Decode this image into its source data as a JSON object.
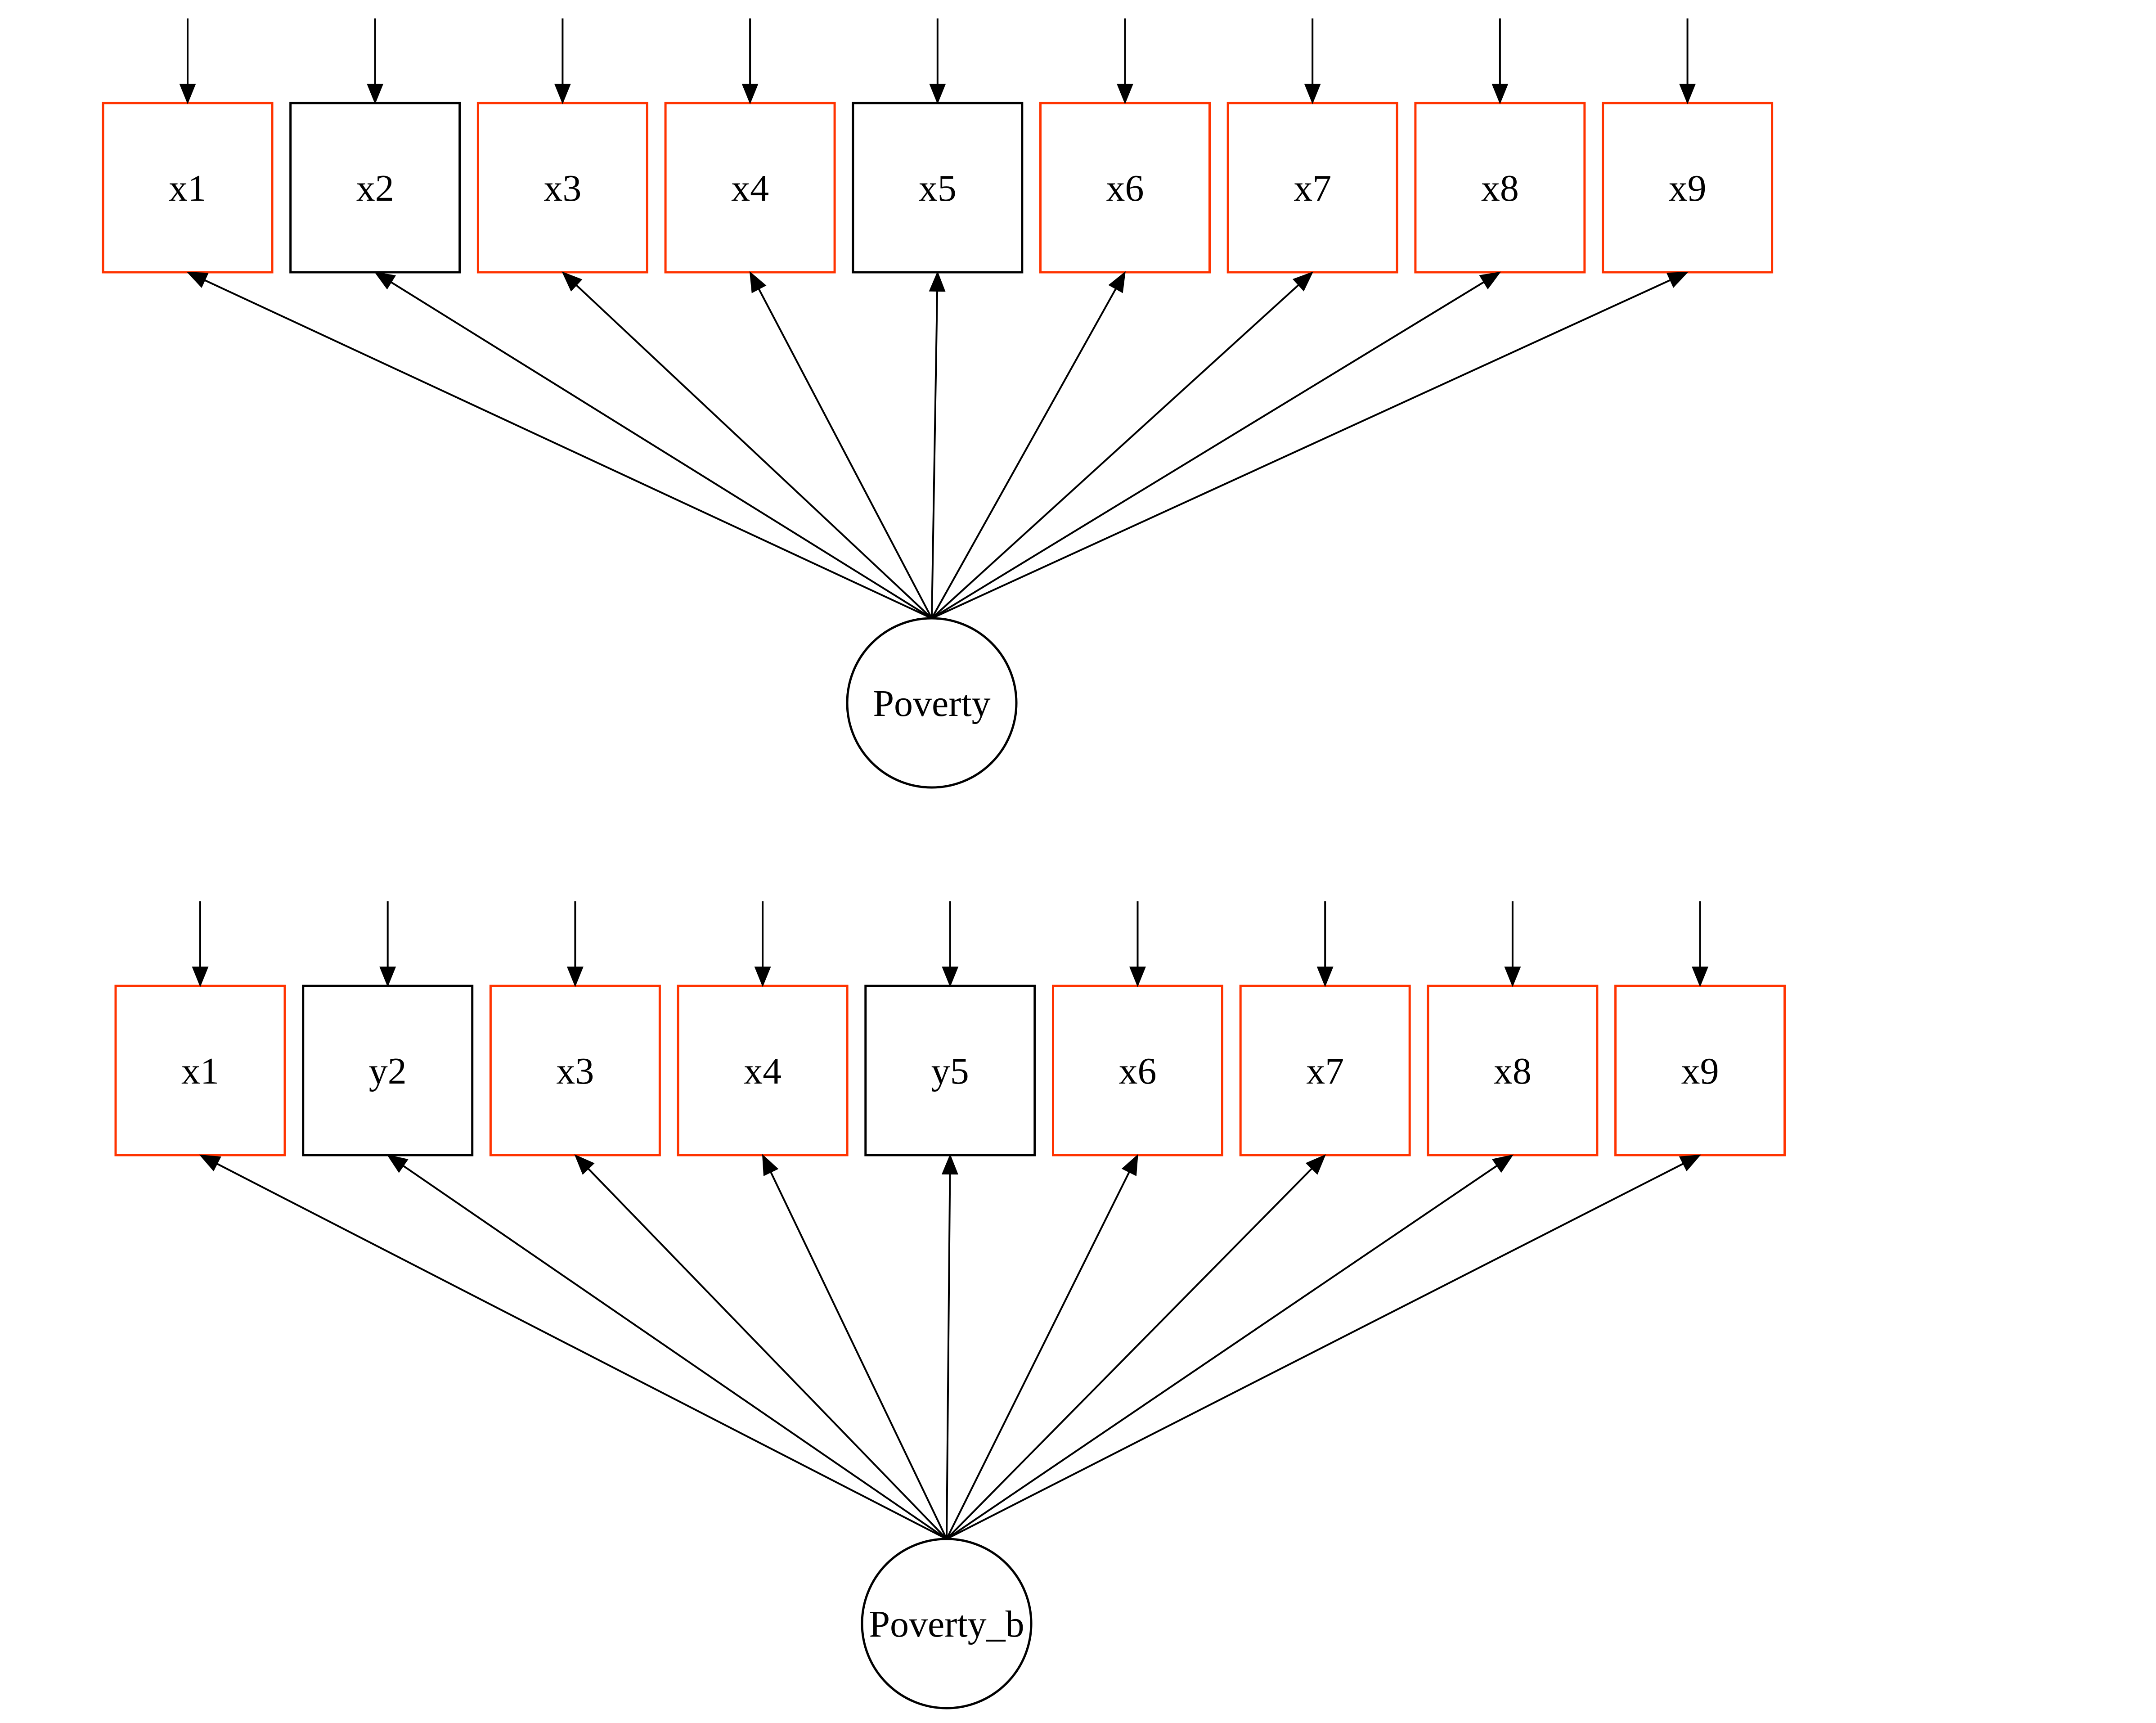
{
  "colors": {
    "highlighted_indicator": "#FF3300",
    "default_indicator": "#000000",
    "edge": "#000000",
    "background": "#FFFFFF"
  },
  "models": [
    {
      "id": "model-a",
      "latent": {
        "label": "Poverty"
      },
      "indicators": [
        {
          "label": "x1",
          "highlighted": true
        },
        {
          "label": "x2",
          "highlighted": false
        },
        {
          "label": "x3",
          "highlighted": true
        },
        {
          "label": "x4",
          "highlighted": true
        },
        {
          "label": "x5",
          "highlighted": false
        },
        {
          "label": "x6",
          "highlighted": true
        },
        {
          "label": "x7",
          "highlighted": true
        },
        {
          "label": "x8",
          "highlighted": true
        },
        {
          "label": "x9",
          "highlighted": true
        }
      ],
      "error_arrows": true
    },
    {
      "id": "model-b",
      "latent": {
        "label": "Poverty_b"
      },
      "indicators": [
        {
          "label": "x1",
          "highlighted": true
        },
        {
          "label": "y2",
          "highlighted": false
        },
        {
          "label": "x3",
          "highlighted": true
        },
        {
          "label": "x4",
          "highlighted": true
        },
        {
          "label": "y5",
          "highlighted": false
        },
        {
          "label": "x6",
          "highlighted": true
        },
        {
          "label": "x7",
          "highlighted": true
        },
        {
          "label": "x8",
          "highlighted": true
        },
        {
          "label": "x9",
          "highlighted": true
        }
      ],
      "error_arrows": true
    }
  ]
}
